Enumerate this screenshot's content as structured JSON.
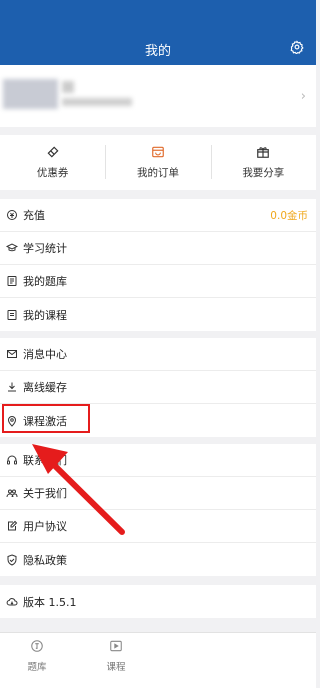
{
  "header": {
    "title": "我的"
  },
  "quick_actions": [
    {
      "icon": "ticket-icon",
      "label": "优惠券"
    },
    {
      "icon": "shop-icon",
      "label": "我的订单"
    },
    {
      "icon": "gift-icon",
      "label": "我要分享"
    }
  ],
  "menu": {
    "group1": [
      {
        "icon": "recharge-icon",
        "label": "充值",
        "value": "0.0金币"
      },
      {
        "icon": "graduation-cap-icon",
        "label": "学习统计"
      },
      {
        "icon": "question-bank-icon",
        "label": "我的题库"
      },
      {
        "icon": "book-icon",
        "label": "我的课程"
      }
    ],
    "group2": [
      {
        "icon": "mail-icon",
        "label": "消息中心"
      },
      {
        "icon": "download-icon",
        "label": "离线缓存"
      },
      {
        "icon": "location-pin-icon",
        "label": "课程激活"
      }
    ],
    "group3": [
      {
        "icon": "headset-icon",
        "label": "联系我们"
      },
      {
        "icon": "users-icon",
        "label": "关于我们"
      },
      {
        "icon": "edit-document-icon",
        "label": "用户协议"
      },
      {
        "icon": "shield-icon",
        "label": "隐私政策"
      }
    ],
    "group4": [
      {
        "icon": "cloud-icon",
        "label": "版本 1.5.1"
      }
    ]
  },
  "tabbar": [
    {
      "icon": "question-bank-tab-icon",
      "label": "题库"
    },
    {
      "icon": "play-icon",
      "label": "课程"
    }
  ],
  "colors": {
    "header": "#1d5fae",
    "accent": "#f0a81c",
    "highlight": "#e51c1c"
  }
}
